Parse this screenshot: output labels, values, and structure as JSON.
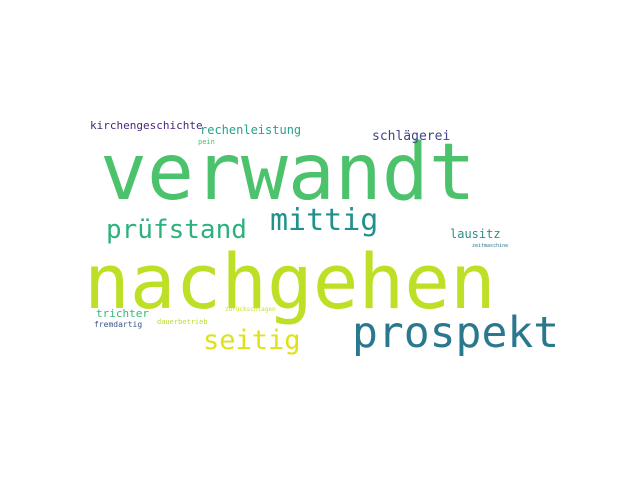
{
  "words": [
    {
      "text": "verwandt",
      "color": "#4cc26c"
    },
    {
      "text": "nachgehen",
      "color": "#bddf26"
    },
    {
      "text": "prospekt",
      "color": "#2a788e"
    },
    {
      "text": "prüfstand",
      "color": "#2db27d"
    },
    {
      "text": "mittig",
      "color": "#21918c"
    },
    {
      "text": "seitig",
      "color": "#dde318"
    },
    {
      "text": "schlägerei",
      "color": "#414487"
    },
    {
      "text": "rechenleistung",
      "color": "#25a18e"
    },
    {
      "text": "kirchengeschichte",
      "color": "#482878"
    },
    {
      "text": "lausitz",
      "color": "#2c8e8c"
    },
    {
      "text": "trichter",
      "color": "#35b779"
    },
    {
      "text": "fremdartig",
      "color": "#3b528b"
    },
    {
      "text": "dauerbetrieb",
      "color": "#b8de29"
    },
    {
      "text": "zurückschlagen",
      "color": "#d0e11c"
    },
    {
      "text": "pein",
      "color": "#4ac16d"
    },
    {
      "text": "zeitmaschine",
      "color": "#2a788e"
    }
  ]
}
